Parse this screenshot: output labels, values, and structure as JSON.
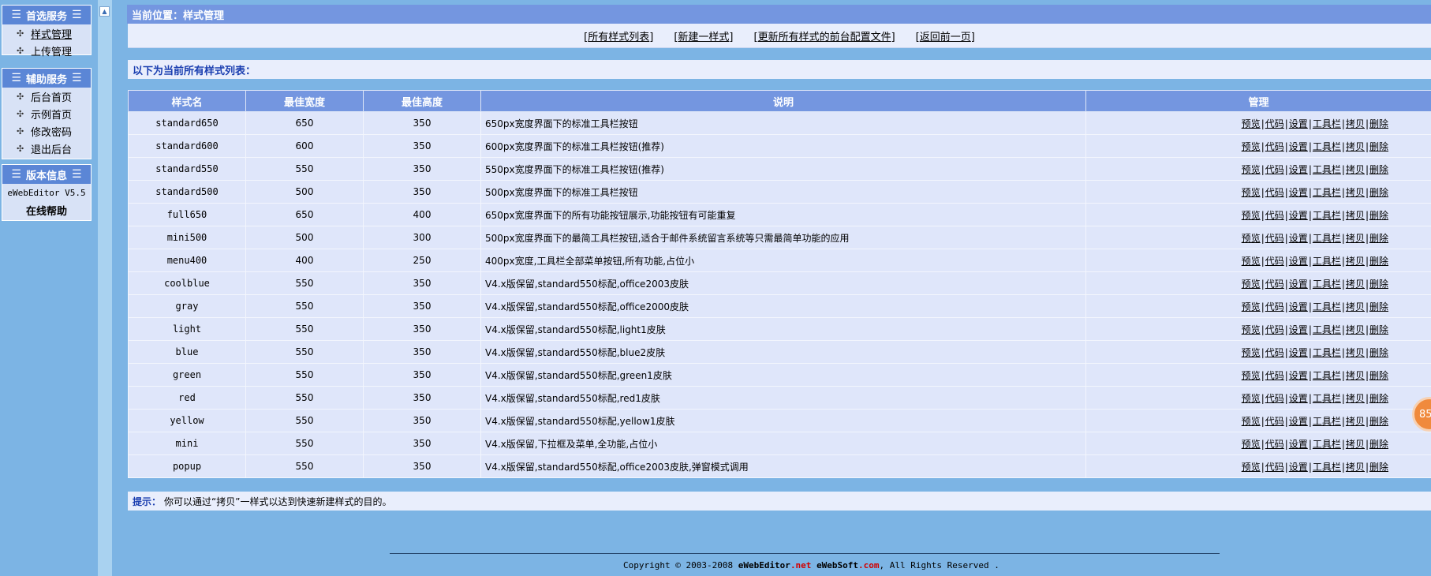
{
  "sidebar": {
    "panels": [
      {
        "title": "首选服务",
        "items": [
          "样式管理",
          "上传管理"
        ]
      },
      {
        "title": "辅助服务",
        "items": [
          "后台首页",
          "示例首页",
          "修改密码",
          "退出后台"
        ]
      },
      {
        "title": "版本信息",
        "version": "eWebEditor V5.5",
        "help": "在线帮助"
      }
    ]
  },
  "breadcrumb": "当前位置：样式管理",
  "toplinks": [
    "所有样式列表",
    "新建一样式",
    "更新所有样式的前台配置文件",
    "返回前一页"
  ],
  "list_title": "以下为当前所有样式列表：",
  "table": {
    "headers": [
      "样式名",
      "最佳宽度",
      "最佳高度",
      "说明",
      "管理"
    ],
    "actions": [
      "预览",
      "代码",
      "设置",
      "工具栏",
      "拷贝",
      "删除"
    ],
    "rows": [
      {
        "name": "standard650",
        "w": "650",
        "h": "350",
        "desc": "650px宽度界面下的标准工具栏按钮"
      },
      {
        "name": "standard600",
        "w": "600",
        "h": "350",
        "desc": "600px宽度界面下的标准工具栏按钮(推荐)"
      },
      {
        "name": "standard550",
        "w": "550",
        "h": "350",
        "desc": "550px宽度界面下的标准工具栏按钮(推荐)"
      },
      {
        "name": "standard500",
        "w": "500",
        "h": "350",
        "desc": "500px宽度界面下的标准工具栏按钮"
      },
      {
        "name": "full650",
        "w": "650",
        "h": "400",
        "desc": "650px宽度界面下的所有功能按钮展示,功能按钮有可能重复"
      },
      {
        "name": "mini500",
        "w": "500",
        "h": "300",
        "desc": "500px宽度界面下的最简工具栏按钮,适合于邮件系统留言系统等只需最简单功能的应用"
      },
      {
        "name": "menu400",
        "w": "400",
        "h": "250",
        "desc": "400px宽度,工具栏全部菜单按钮,所有功能,占位小"
      },
      {
        "name": "coolblue",
        "w": "550",
        "h": "350",
        "desc": "V4.x版保留,standard550标配,office2003皮肤"
      },
      {
        "name": "gray",
        "w": "550",
        "h": "350",
        "desc": "V4.x版保留,standard550标配,office2000皮肤"
      },
      {
        "name": "light",
        "w": "550",
        "h": "350",
        "desc": "V4.x版保留,standard550标配,light1皮肤"
      },
      {
        "name": "blue",
        "w": "550",
        "h": "350",
        "desc": "V4.x版保留,standard550标配,blue2皮肤"
      },
      {
        "name": "green",
        "w": "550",
        "h": "350",
        "desc": "V4.x版保留,standard550标配,green1皮肤"
      },
      {
        "name": "red",
        "w": "550",
        "h": "350",
        "desc": "V4.x版保留,standard550标配,red1皮肤"
      },
      {
        "name": "yellow",
        "w": "550",
        "h": "350",
        "desc": "V4.x版保留,standard550标配,yellow1皮肤"
      },
      {
        "name": "mini",
        "w": "550",
        "h": "350",
        "desc": "V4.x版保留,下拉框及菜单,全功能,占位小"
      },
      {
        "name": "popup",
        "w": "550",
        "h": "350",
        "desc": "V4.x版保留,standard550标配,office2003皮肤,弹窗模式调用"
      }
    ]
  },
  "tip": {
    "label": "提示：",
    "text": "你可以通过“拷贝”一样式以达到快速新建样式的目的。"
  },
  "footer": {
    "prefix": "Copyright © 2003-2008 ",
    "brand1": "eWebEditor",
    "brand1_tld": ".net",
    "brand2": "eWebSoft",
    "brand2_tld": ".com",
    "suffix": ", All Rights Reserved ."
  },
  "badge": "85",
  "colors": {
    "header_blue": "#7496e0",
    "panel_head": "#5b86d6",
    "page_bg": "#7cb4e4",
    "row_bg": "#dfe6fa"
  },
  "icons": {
    "menu": "hamburger-icon",
    "bullet": "crosshair-bullet-icon",
    "collapse": "arrow-up-icon"
  }
}
